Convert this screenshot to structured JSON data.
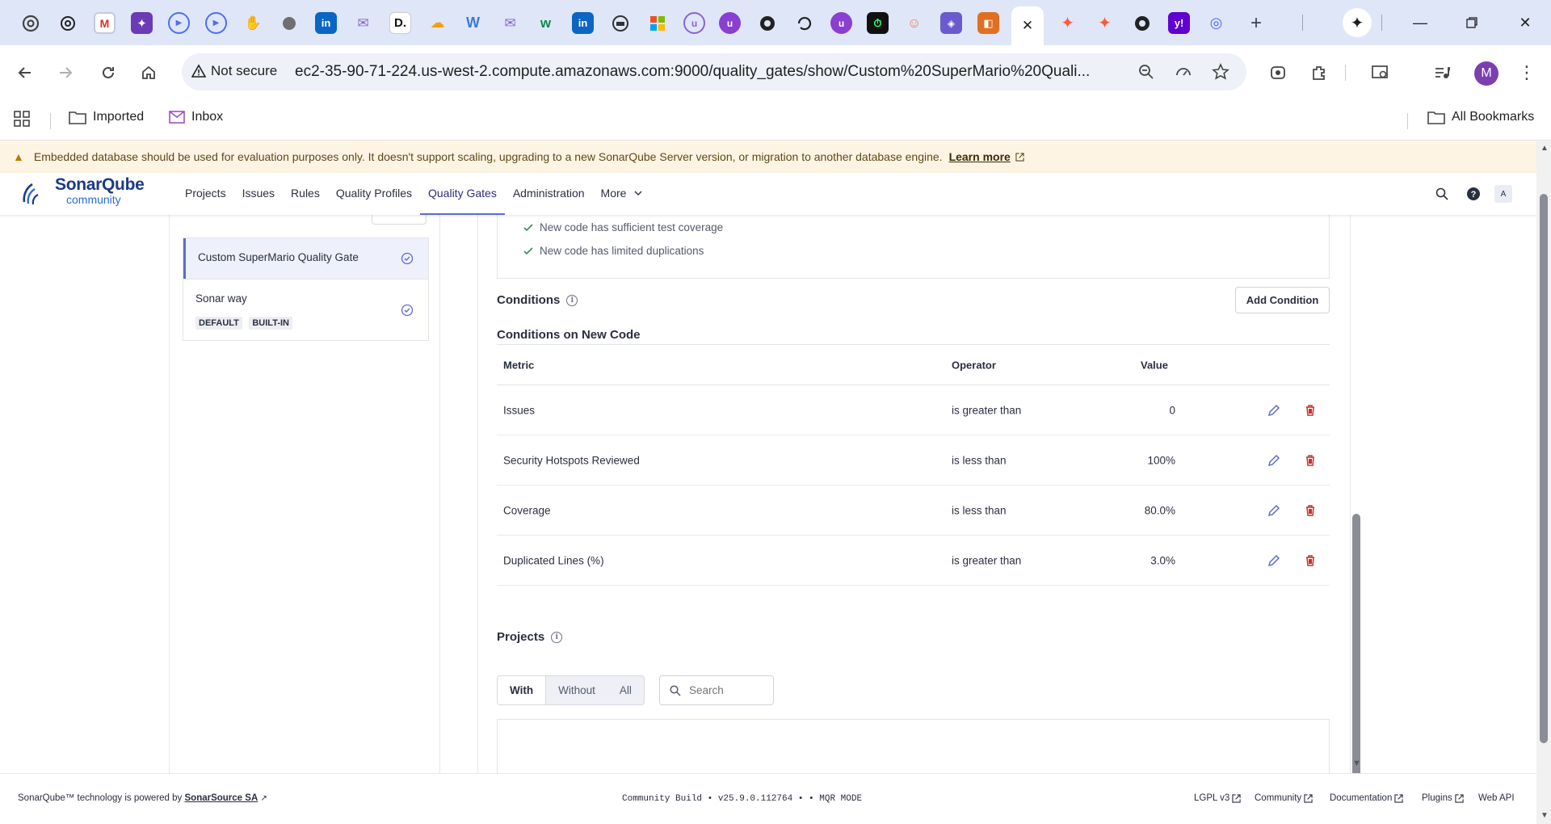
{
  "browser": {
    "active_tab_close": "✕",
    "new_tab": "+",
    "security_label": "Not secure",
    "url": "ec2-35-90-71-224.us-west-2.compute.amazonaws.com:9000/quality_gates/show/Custom%20SuperMario%20Quali...",
    "profile_initial": "M",
    "bookmarks": [
      {
        "label": "Imported"
      },
      {
        "label": "Inbox"
      }
    ],
    "all_bookmarks": "All Bookmarks"
  },
  "banner": {
    "message": "Embedded database should be used for evaluation purposes only. It doesn't support scaling, upgrading to a new SonarQube Server version, or migration to another database engine.",
    "link": "Learn more"
  },
  "nav": {
    "logo_main": "SonarQube",
    "logo_sub": "community",
    "items": [
      "Projects",
      "Issues",
      "Rules",
      "Quality Profiles",
      "Quality Gates",
      "Administration",
      "More"
    ],
    "avatar": "A"
  },
  "gates": [
    {
      "name": "Custom SuperMario Quality Gate",
      "tags": []
    },
    {
      "name": "Sonar way",
      "tags": [
        "DEFAULT",
        "BUILT-IN"
      ]
    }
  ],
  "clean_as_you_code": [
    "New code has sufficient test coverage",
    "New code has limited duplications"
  ],
  "conditions": {
    "title": "Conditions",
    "add_button": "Add Condition",
    "subtitle": "Conditions on New Code",
    "headers": {
      "metric": "Metric",
      "operator": "Operator",
      "value": "Value"
    },
    "rows": [
      {
        "metric": "Issues",
        "operator": "is greater than",
        "value": "0"
      },
      {
        "metric": "Security Hotspots Reviewed",
        "operator": "is less than",
        "value": "100%"
      },
      {
        "metric": "Coverage",
        "operator": "is less than",
        "value": "80.0%"
      },
      {
        "metric": "Duplicated Lines (%)",
        "operator": "is greater than",
        "value": "3.0%"
      }
    ]
  },
  "projects": {
    "title": "Projects",
    "filters": [
      "With",
      "Without",
      "All"
    ],
    "search_placeholder": "Search"
  },
  "footer": {
    "powered_prefix": "SonarQube™ technology is powered by",
    "powered_link": "SonarSource SA",
    "build": "Community Build • v25.9.0.112764 • • MQR MODE",
    "links": [
      "LGPL v3",
      "Community",
      "Documentation",
      "Plugins",
      "Web API"
    ]
  },
  "colors": {
    "accent": "#5d6cd1",
    "danger": "#c9302c",
    "banner_bg": "#fdf4e3"
  }
}
